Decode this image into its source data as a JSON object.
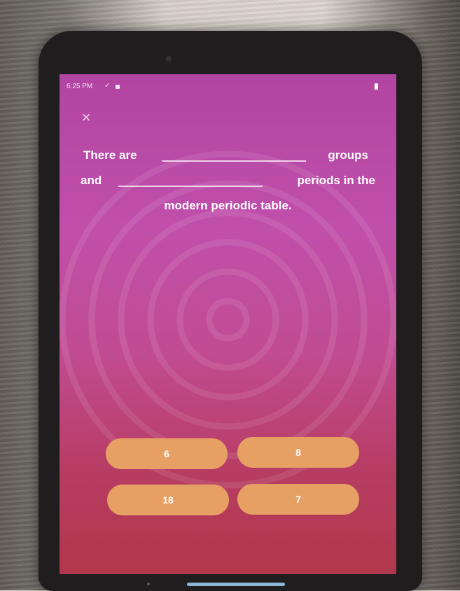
{
  "status_bar": {
    "time": "6:25 PM",
    "icons": [
      "check-icon",
      "lock-icon",
      "battery-icon"
    ]
  },
  "close_icon": {
    "glyph": "×",
    "name": "close-icon"
  },
  "question": {
    "line1_start": "There are",
    "line1_end": "groups",
    "line2_start": "and",
    "line2_end": "periods in the",
    "line3": "modern periodic table."
  },
  "answers": [
    {
      "label": "6"
    },
    {
      "label": "8"
    },
    {
      "label": "18"
    },
    {
      "label": "7"
    }
  ],
  "colors": {
    "screen_top": "#b244a2",
    "screen_bottom": "#b1384b",
    "answer_button": "#e7a064",
    "text": "#ffffff"
  }
}
